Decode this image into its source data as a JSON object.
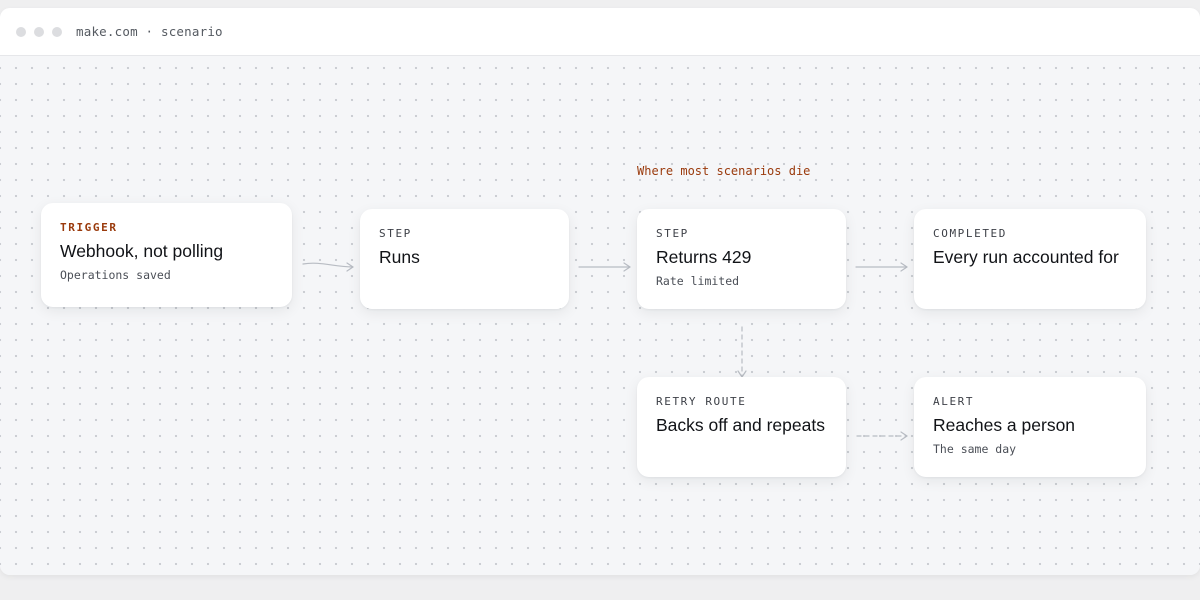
{
  "window": {
    "address": "make.com · scenario"
  },
  "annotation": "Where most scenarios die",
  "nodes": {
    "trigger": {
      "kicker": "TRIGGER",
      "title": "Webhook, not polling",
      "subtitle": "Operations saved"
    },
    "runs": {
      "kicker": "STEP",
      "title": "Runs"
    },
    "returns": {
      "kicker": "STEP",
      "title": "Returns 429",
      "subtitle": "Rate limited"
    },
    "completed": {
      "kicker": "COMPLETED",
      "title": "Every run accounted for"
    },
    "retry": {
      "kicker": "RETRY ROUTE",
      "title": "Backs off and repeats"
    },
    "alert": {
      "kicker": "ALERT",
      "title": "Reaches a person",
      "subtitle": "The same day"
    }
  },
  "colors": {
    "accent": "#9a3a0c",
    "connector": "#b8bcc3"
  }
}
